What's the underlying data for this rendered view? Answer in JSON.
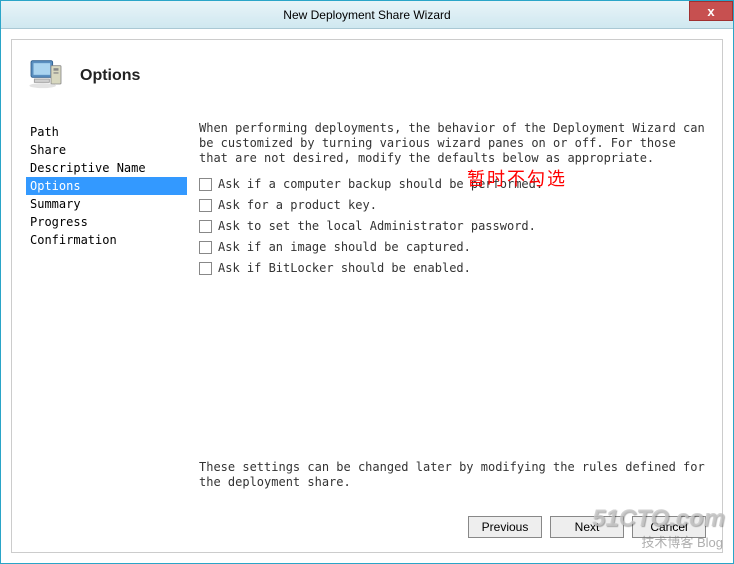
{
  "window": {
    "title": "New Deployment Share Wizard",
    "close": "x"
  },
  "header": {
    "title": "Options"
  },
  "nav": {
    "items": [
      {
        "label": "Path",
        "selected": false
      },
      {
        "label": "Share",
        "selected": false
      },
      {
        "label": "Descriptive Name",
        "selected": false
      },
      {
        "label": "Options",
        "selected": true
      },
      {
        "label": "Summary",
        "selected": false
      },
      {
        "label": "Progress",
        "selected": false
      },
      {
        "label": "Confirmation",
        "selected": false
      }
    ]
  },
  "main": {
    "description": "When performing deployments, the behavior of the Deployment Wizard can be customized by turning various wizard panes on or off.  For those that are not desired, modify the defaults below as appropriate.",
    "checkboxes": [
      {
        "label": "Ask if a computer backup should be performed.",
        "checked": false
      },
      {
        "label": "Ask for a product key.",
        "checked": false
      },
      {
        "label": "Ask to set the local Administrator password.",
        "checked": false
      },
      {
        "label": "Ask if an image should be captured.",
        "checked": false
      },
      {
        "label": "Ask if BitLocker should be enabled.",
        "checked": false
      }
    ],
    "footer_note": "These settings can be changed later by modifying the rules defined for the deployment share.",
    "annotation": "暂时不勾选"
  },
  "buttons": {
    "previous": "Previous",
    "next": "Next",
    "cancel": "Cancel"
  },
  "watermark": {
    "line1": "51CTO.com",
    "line2": "技术博客 Blog"
  }
}
